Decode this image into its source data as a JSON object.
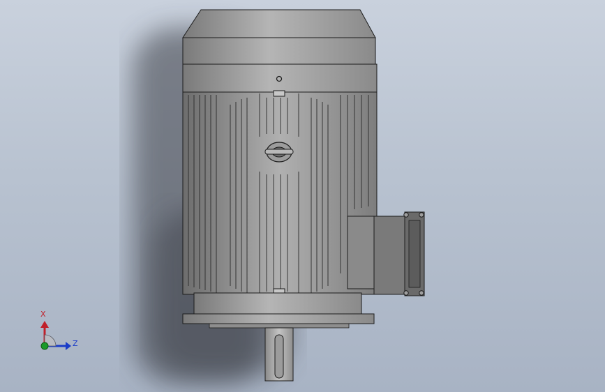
{
  "viewport": {
    "model": "motor-model",
    "background_top": "#c9d1dd",
    "background_bottom": "#a8b3c4"
  },
  "triad": {
    "x_label": "X",
    "z_label": "Z",
    "x_color": "#c0202a",
    "z_color": "#1a3cc8",
    "y_color": "#1a9a2a"
  }
}
